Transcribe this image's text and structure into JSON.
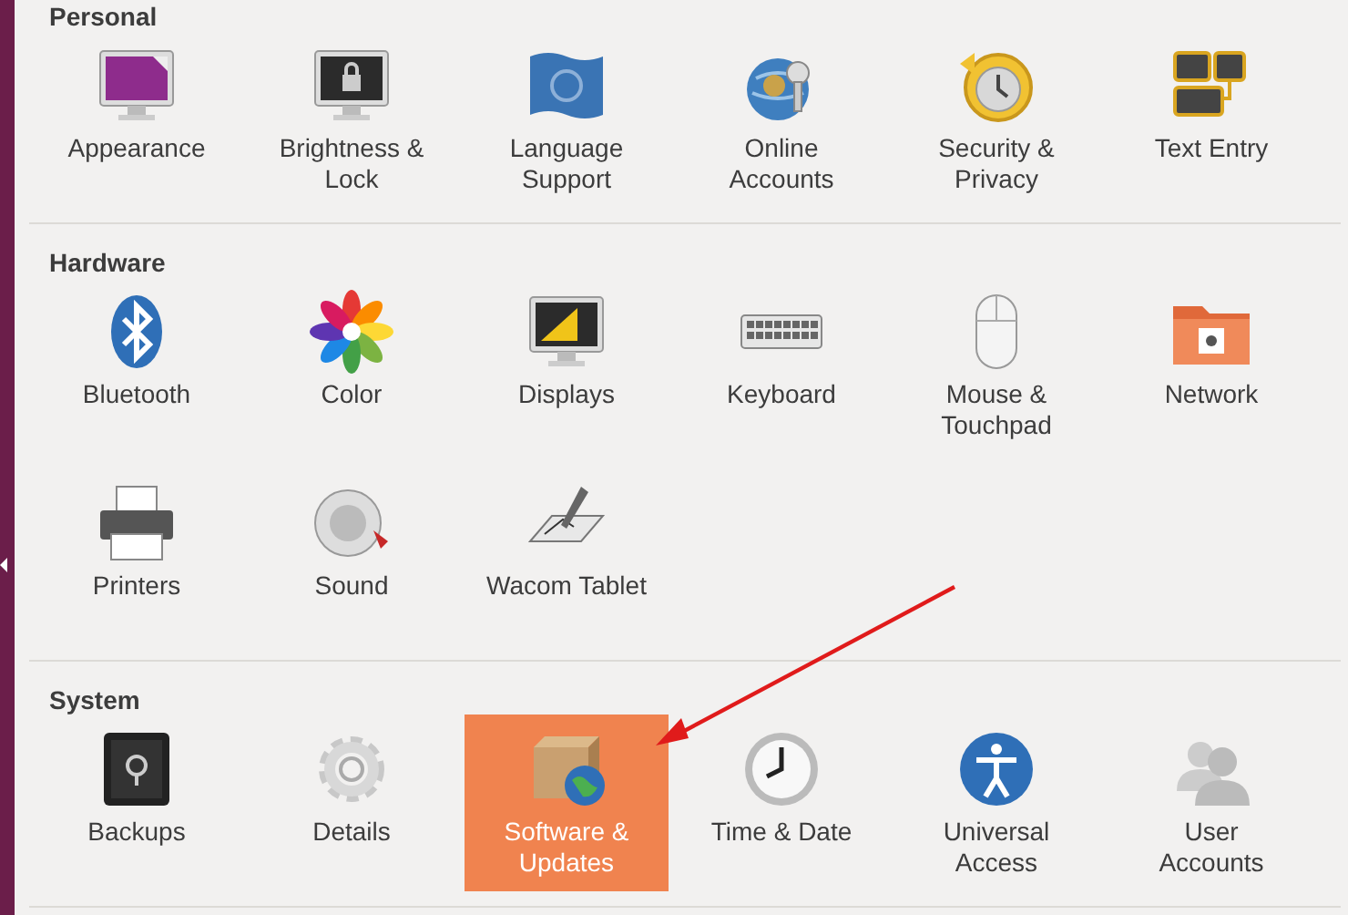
{
  "sections": [
    {
      "title": "Personal",
      "items": [
        {
          "label": "Appearance",
          "selected": false
        },
        {
          "label": "Brightness &\nLock",
          "selected": false
        },
        {
          "label": "Language\nSupport",
          "selected": false
        },
        {
          "label": "Online\nAccounts",
          "selected": false
        },
        {
          "label": "Security &\nPrivacy",
          "selected": false
        },
        {
          "label": "Text Entry",
          "selected": false
        }
      ]
    },
    {
      "title": "Hardware",
      "items": [
        {
          "label": "Bluetooth",
          "selected": false
        },
        {
          "label": "Color",
          "selected": false
        },
        {
          "label": "Displays",
          "selected": false
        },
        {
          "label": "Keyboard",
          "selected": false
        },
        {
          "label": "Mouse &\nTouchpad",
          "selected": false
        },
        {
          "label": "Network",
          "selected": false
        },
        {
          "label": "Printers",
          "selected": false
        },
        {
          "label": "Sound",
          "selected": false
        },
        {
          "label": "Wacom Tablet",
          "selected": false
        }
      ]
    },
    {
      "title": "System",
      "items": [
        {
          "label": "Backups",
          "selected": false
        },
        {
          "label": "Details",
          "selected": false
        },
        {
          "label": "Software &\nUpdates",
          "selected": true
        },
        {
          "label": "Time & Date",
          "selected": false
        },
        {
          "label": "Universal\nAccess",
          "selected": false
        },
        {
          "label": "User\nAccounts",
          "selected": false
        }
      ]
    }
  ]
}
